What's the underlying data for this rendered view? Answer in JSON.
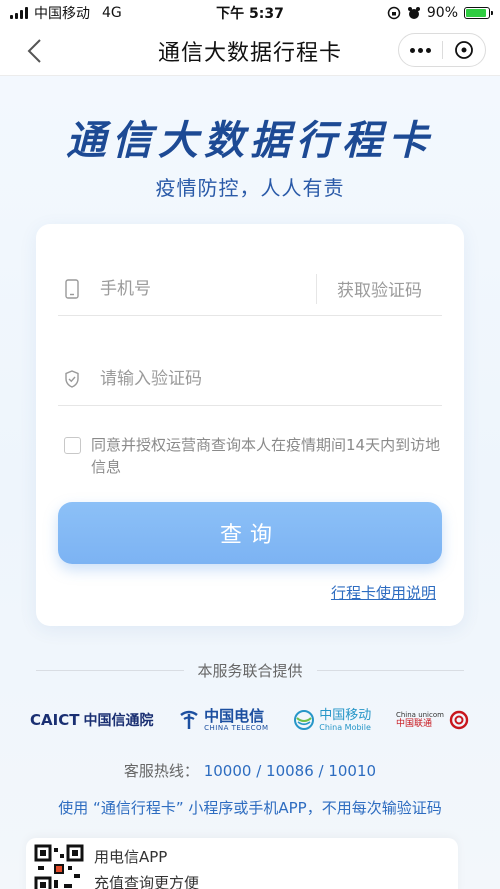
{
  "status_bar": {
    "carrier": "中国移动",
    "network": "4G",
    "time": "下午 5:37",
    "battery": "90%",
    "battery_level": 0.9
  },
  "nav": {
    "title": "通信大数据行程卡"
  },
  "hero": {
    "title": "通信大数据行程卡",
    "subtitle": "疫情防控，人人有责"
  },
  "form": {
    "phone_placeholder": "手机号",
    "get_code_label": "获取验证码",
    "code_placeholder": "请输入验证码",
    "agree_text": "同意并授权运营商查询本人在疫情期间14天内到访地信息",
    "query_button": "查询",
    "guide_link": "行程卡使用说明"
  },
  "providers": {
    "heading": "本服务联合提供",
    "caict_mark": "CAICT",
    "caict_name": "中国信通院",
    "telecom_name": "中国电信",
    "telecom_en": "CHINA TELECOM",
    "mobile_name": "中国移动",
    "mobile_en": "China Mobile",
    "unicom_en": "China unicom",
    "unicom_name": "中国联通"
  },
  "hotline": {
    "label": "客服热线：",
    "numbers": "10000 / 10086 / 10010"
  },
  "promo_text": "使用 “通信行程卡” 小程序或手机APP，不用每次输验证码",
  "app_card": {
    "line1": "用电信APP",
    "line2": "充值查询更方便"
  },
  "colors": {
    "brand_blue": "#1d4a94",
    "link_blue": "#2d6cc0",
    "button_blue": "#7cb3f3",
    "unicom_red": "#c8161d"
  }
}
